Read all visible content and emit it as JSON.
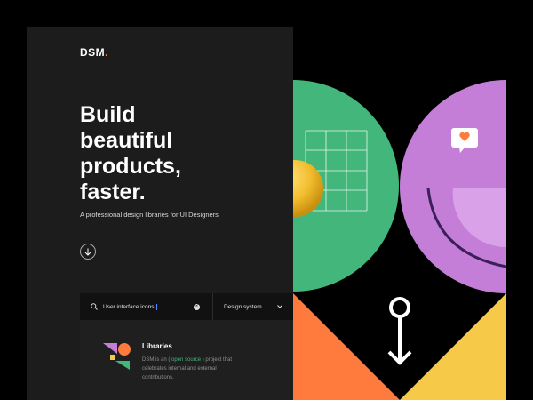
{
  "header": {
    "logo": "DSM",
    "logo_dot": "."
  },
  "hero": {
    "title_lines": [
      "Build",
      "beautiful",
      "products,",
      "faster."
    ],
    "subtitle": "A professional design libraries for UI Designers"
  },
  "search": {
    "value": "User interface icons",
    "select_value": "Design system"
  },
  "libraries": {
    "title": "Libraries",
    "desc_before": "DSM is an ",
    "desc_link": "( open source )",
    "desc_after": " project that celebrates internal and external contributions."
  },
  "colors": {
    "background": "#1c1c1c",
    "green": "#43b77b",
    "purple": "#c57ed8",
    "orange": "#ff7a3d",
    "yellow": "#f7c948",
    "white": "#ffffff"
  },
  "icons": [
    "menu-icon",
    "arrow-down-icon",
    "search-icon",
    "clear-icon",
    "chevron-down-icon",
    "heart-icon"
  ]
}
